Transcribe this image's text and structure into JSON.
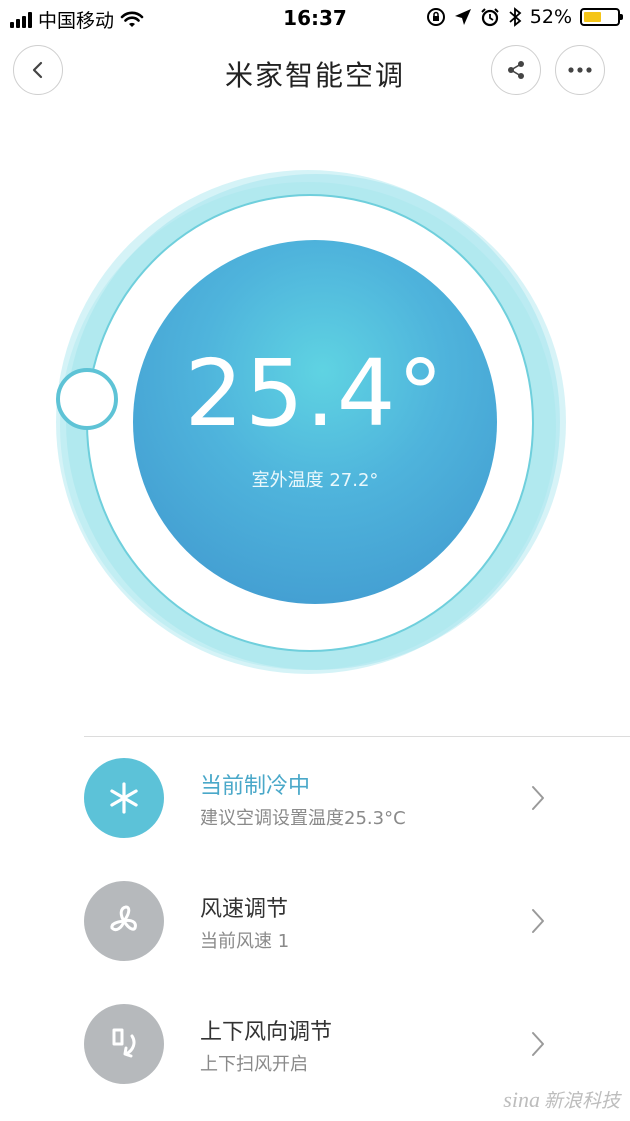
{
  "status_bar": {
    "carrier": "中国移动",
    "time": "16:37",
    "battery_text": "52%",
    "battery_level": 0.52,
    "icons": [
      "signal-bars-icon",
      "wifi-icon",
      "rotation-lock-icon",
      "location-arrow-icon",
      "alarm-icon",
      "bluetooth-icon",
      "battery-icon"
    ]
  },
  "nav": {
    "title": "米家智能空调",
    "back_icon": "chevron-left-icon",
    "share_icon": "share-icon",
    "more_icon": "more-dots-icon"
  },
  "dial": {
    "temperature": "25.4°",
    "outdoor_label": "室外温度 27.2°",
    "colors": {
      "ring": "#8fdde8",
      "inner_center": "#5fd3e2",
      "inner_edge": "#3e94cd",
      "knob_border": "#5ec3d6"
    }
  },
  "list": [
    {
      "title": "当前制冷中",
      "subtitle": "建议空调设置温度25.3°C",
      "icon": "snowflake-icon",
      "icon_color": "#5cc2d8",
      "active": true
    },
    {
      "title": "风速调节",
      "subtitle": "当前风速 1",
      "icon": "fan-icon",
      "icon_color": "#b6b9bc",
      "active": false
    },
    {
      "title": "上下风向调节",
      "subtitle": "上下扫风开启",
      "icon": "airflow-direction-icon",
      "icon_color": "#b6b9bc",
      "active": false
    }
  ],
  "watermark": {
    "brand": "sina",
    "text": "新浪科技"
  }
}
